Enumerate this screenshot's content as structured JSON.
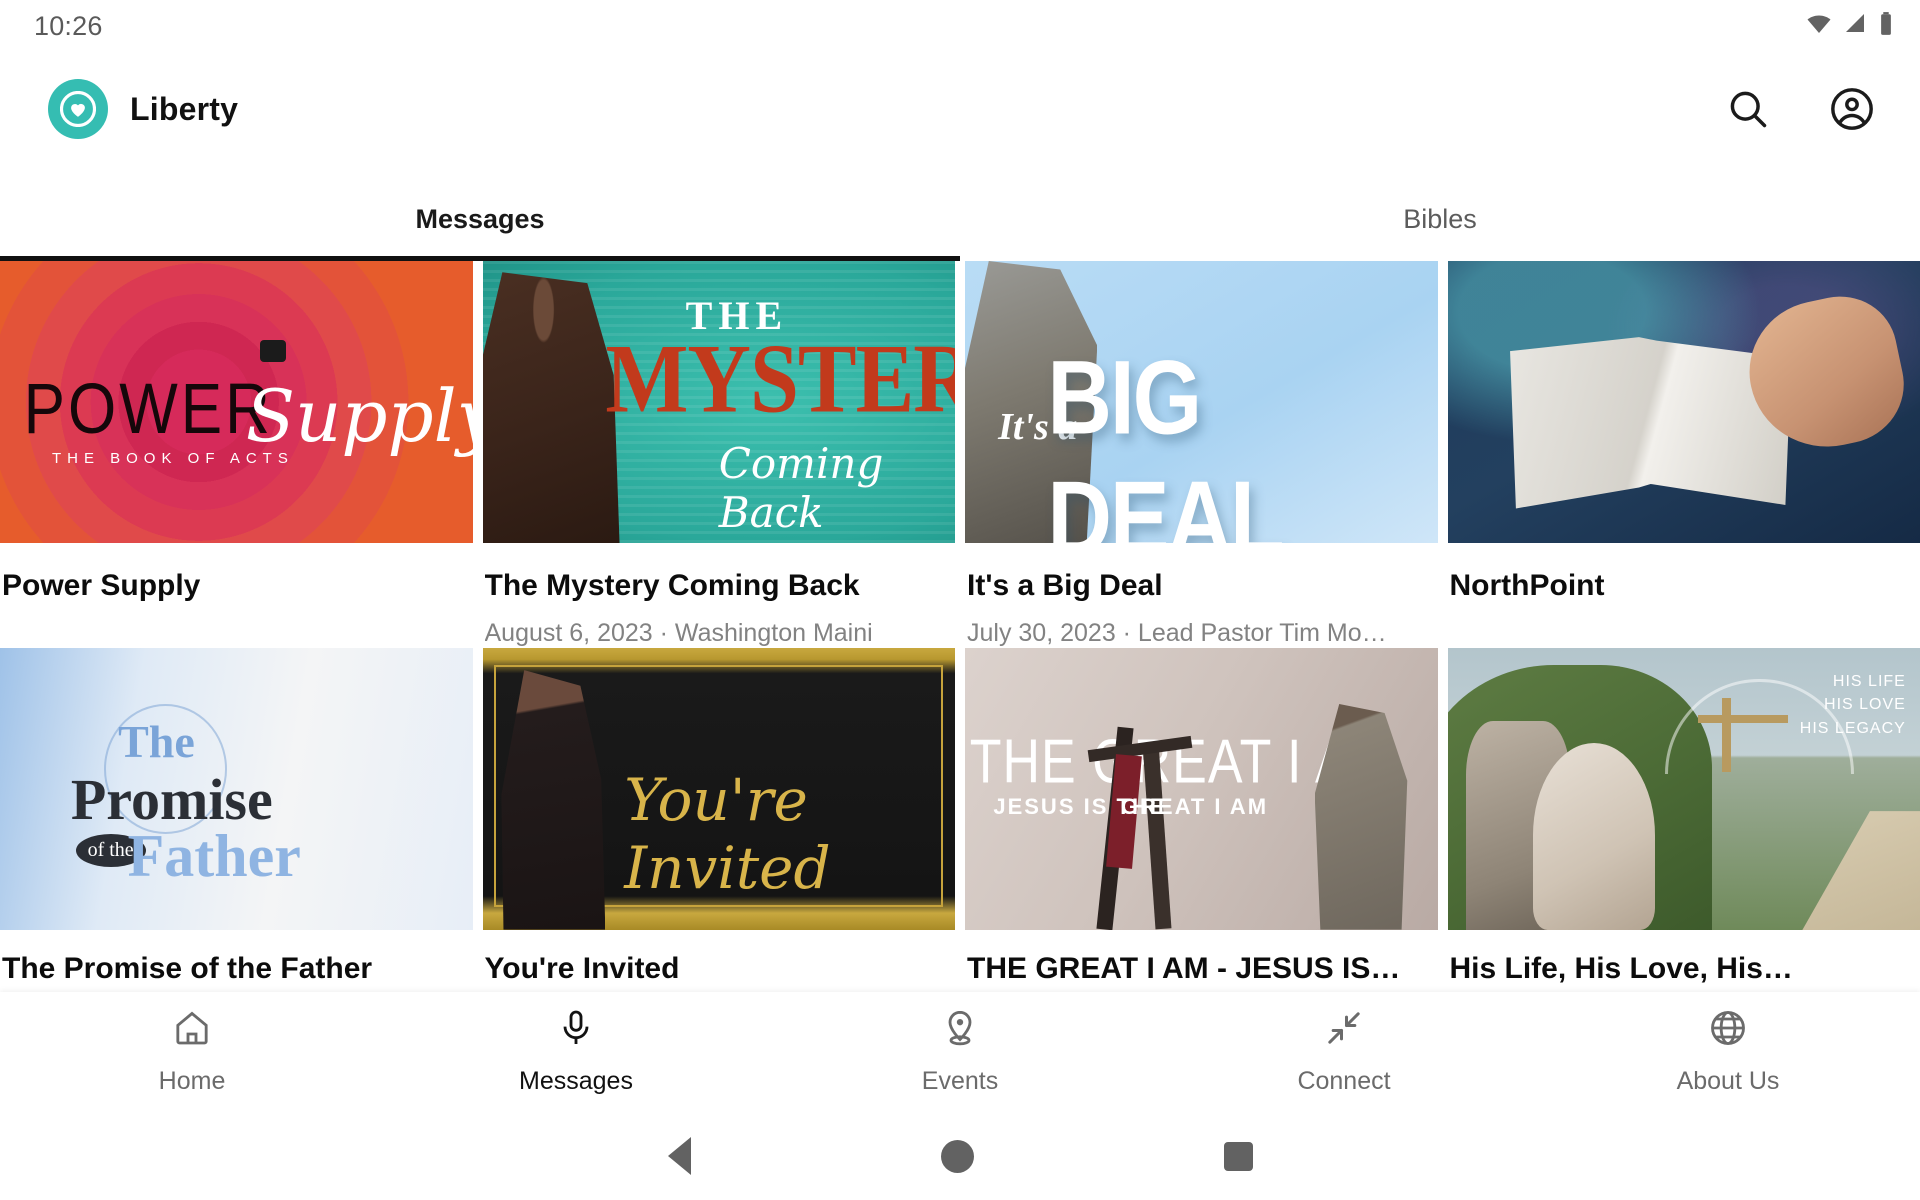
{
  "status_bar": {
    "time": "10:26",
    "icons": [
      "wifi-icon",
      "cellular-signal-icon",
      "battery-icon"
    ]
  },
  "app_bar": {
    "brand_name": "Liberty",
    "logo_icon": "heart-in-circle-logo",
    "logo_color": "#35bdb2",
    "actions": [
      {
        "name": "search-icon",
        "label": "Search"
      },
      {
        "name": "account-circle-icon",
        "label": "Account"
      }
    ]
  },
  "tabs": {
    "items": [
      {
        "label": "Messages",
        "active": true
      },
      {
        "label": "Bibles",
        "active": false
      }
    ]
  },
  "content": {
    "rows": [
      {
        "cards": [
          {
            "title": "Power Supply",
            "meta": "",
            "art": {
              "style": "art-power",
              "word": "POWER",
              "script": "Supply",
              "sub": "THE BOOK OF ACTS"
            }
          },
          {
            "title": "The Mystery Coming Back",
            "meta": "August 6, 2023 · Washington Maini",
            "art": {
              "style": "art-mystery",
              "line1": "THE",
              "line2": "MYSTERY",
              "script": "Coming Back"
            }
          },
          {
            "title": "It's a Big Deal",
            "meta": "July 30, 2023 · Lead Pastor Tim Mo…",
            "art": {
              "style": "art-bigdeal",
              "script": "It's a",
              "word": "BIG DEAL"
            }
          },
          {
            "title": "NorthPoint",
            "meta": "",
            "art": {
              "style": "art-bible"
            }
          }
        ]
      },
      {
        "cards": [
          {
            "title": "The Promise of the Father",
            "meta": "",
            "art": {
              "style": "art-promise",
              "the": "The",
              "promise": "Promise",
              "ofthe": "of the",
              "father": "Father"
            }
          },
          {
            "title": "You're Invited",
            "meta": "",
            "art": {
              "style": "art-invited",
              "script": "You're Invited"
            }
          },
          {
            "title": "THE GREAT I AM - JESUS IS…",
            "meta": "",
            "art": {
              "style": "art-greatiam",
              "main": "THE GREAT I AM",
              "sub": "JESUS IS THE",
              "sub2": "GREAT I AM"
            }
          },
          {
            "title": "His Life, His Love, His…",
            "meta": "",
            "art": {
              "style": "art-hislife",
              "words": "HIS LIFE\nHIS LOVE\nHIS LEGACY"
            }
          }
        ]
      }
    ]
  },
  "bottom_nav": {
    "items": [
      {
        "label": "Home",
        "icon": "home-icon",
        "active": false
      },
      {
        "label": "Messages",
        "icon": "microphone-icon",
        "active": true
      },
      {
        "label": "Events",
        "icon": "location-pin-icon",
        "active": false
      },
      {
        "label": "Connect",
        "icon": "collapse-arrows-icon",
        "active": false
      },
      {
        "label": "About Us",
        "icon": "globe-icon",
        "active": false
      }
    ]
  },
  "system_nav": {
    "buttons": [
      {
        "name": "android-back-button"
      },
      {
        "name": "android-home-button"
      },
      {
        "name": "android-recents-button"
      }
    ]
  }
}
